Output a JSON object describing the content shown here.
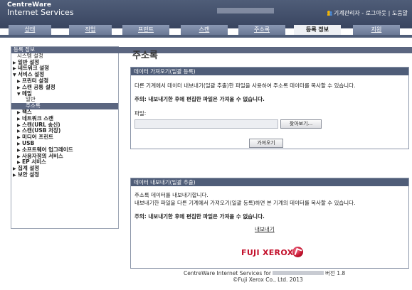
{
  "app": {
    "brand_line1": "CentreWare",
    "brand_line2": "Internet Services"
  },
  "user": {
    "label": "기계관리자 - 로그아웃 | 도움말"
  },
  "tabs": [
    {
      "label": "상태"
    },
    {
      "label": "작업"
    },
    {
      "label": "프린트"
    },
    {
      "label": "스캔"
    },
    {
      "label": "주소록"
    },
    {
      "label": "등록 정보",
      "active": true
    },
    {
      "label": "지원"
    }
  ],
  "sidebar": {
    "items": [
      {
        "label": "등록 정보",
        "type": "header",
        "indent": 0
      },
      {
        "label": "설정 메뉴",
        "indent": 1
      },
      {
        "label": "시스템 설정",
        "indent": 1
      },
      {
        "label": "일반 설정",
        "arrow": "▶",
        "indent": 0,
        "bold": true
      },
      {
        "label": "네트워크 설정",
        "arrow": "▶",
        "indent": 0,
        "bold": true
      },
      {
        "label": "서비스 설정",
        "arrow": "▼",
        "indent": 0,
        "bold": true
      },
      {
        "label": "프린터 설정",
        "arrow": "▶",
        "indent": 1,
        "bold": true
      },
      {
        "label": "스캔 공통 설정",
        "arrow": "▶",
        "indent": 1,
        "bold": true
      },
      {
        "label": "메일",
        "arrow": "▼",
        "indent": 1,
        "bold": true
      },
      {
        "label": "일반",
        "indent": 3
      },
      {
        "label": "주소록",
        "indent": 3,
        "selected": true
      },
      {
        "label": "팩스",
        "arrow": "▶",
        "indent": 1,
        "bold": true
      },
      {
        "label": "네트워크 스캔",
        "arrow": "▶",
        "indent": 1,
        "bold": true
      },
      {
        "label": "스캔(URL 송신)",
        "arrow": "▶",
        "indent": 1,
        "bold": true
      },
      {
        "label": "스캔(USB 저장)",
        "arrow": "▶",
        "indent": 1,
        "bold": true
      },
      {
        "label": "미디어 프린트",
        "arrow": "▶",
        "indent": 1,
        "bold": true
      },
      {
        "label": "USB",
        "arrow": "▶",
        "indent": 1,
        "bold": true
      },
      {
        "label": "소프트웨어 업그레이드",
        "arrow": "▶",
        "indent": 1,
        "bold": true
      },
      {
        "label": "사용자정의 서비스",
        "arrow": "▶",
        "indent": 1,
        "bold": true
      },
      {
        "label": "EP 서비스",
        "arrow": "▶",
        "indent": 1,
        "bold": true
      },
      {
        "label": "집계 설정",
        "arrow": "▶",
        "indent": 0,
        "bold": true
      },
      {
        "label": "보안 설정",
        "arrow": "▶",
        "indent": 0,
        "bold": true
      }
    ]
  },
  "main": {
    "title": "주소록",
    "import": {
      "header": "데이터 가져오기(일괄 등록)",
      "desc": "다른 기계에서 데이터 내보내기(일괄 추출)한 파일을 사용하여 주소록 데이터를 복사할 수 있습니다.",
      "note": "주의: 내보내기한 후에 편집한 파일은 가져올 수 없습니다.",
      "file_label": "파일:",
      "browse_label": "찾아보기...",
      "import_button": "가져오기"
    },
    "export": {
      "header": "데이터 내보내기(일괄 추출)",
      "desc1": "주소록 데이터를 내보내기합니다.",
      "desc2": "내보내기한 파일을 다른 기계에서 가져오기(일괄 등록)하면 본 기계의 데이터를 복사할 수 있습니다.",
      "note": "주의: 내보내기한 후에 편집한 파일은 가져올 수 없습니다.",
      "export_link": "내보내기"
    }
  },
  "footer": {
    "logo": "FUJI XEROX",
    "line1_prefix": "CentreWare Internet Services for",
    "line1_suffix": "버전 1.8",
    "line2": "©Fuji Xerox Co., Ltd. 2013"
  },
  "colors": {
    "header_bg": "#4f5d78",
    "tab_bg": "#7f8ca8",
    "selected_bg": "#5b6680",
    "logo_red": "#c3102b"
  }
}
